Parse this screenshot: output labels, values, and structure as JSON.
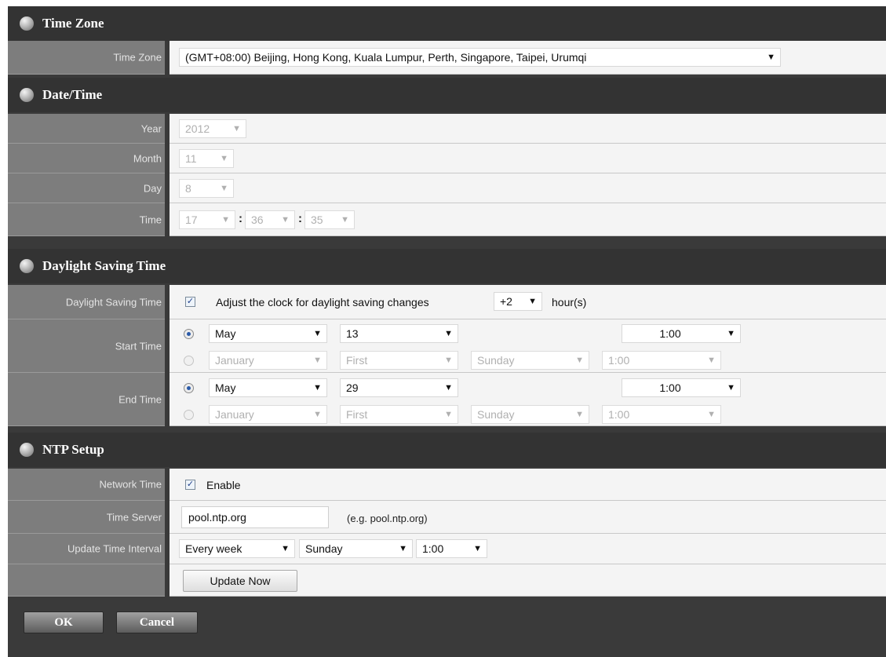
{
  "time_zone_section": {
    "title": "Time Zone",
    "label": "Time Zone",
    "value": "(GMT+08:00) Beijing, Hong Kong, Kuala Lumpur, Perth, Singapore, Taipei, Urumqi"
  },
  "datetime_section": {
    "title": "Date/Time",
    "year_label": "Year",
    "year_value": "2012",
    "month_label": "Month",
    "month_value": "11",
    "day_label": "Day",
    "day_value": "8",
    "time_label": "Time",
    "hour_value": "17",
    "minute_value": "36",
    "second_value": "35",
    "colon": ":"
  },
  "dst_section": {
    "title": "Daylight Saving Time",
    "dst_label": "Daylight Saving Time",
    "adjust_text": "Adjust the clock for daylight saving changes",
    "adjust_checked": true,
    "offset_value": "+2",
    "hours_text": "hour(s)",
    "start_label": "Start Time",
    "start_fixed": {
      "month": "May",
      "day": "13",
      "time": "1:00",
      "selected": true
    },
    "start_relative": {
      "month": "January",
      "week": "First",
      "weekday": "Sunday",
      "time": "1:00",
      "selected": false
    },
    "end_label": "End Time",
    "end_fixed": {
      "month": "May",
      "day": "29",
      "time": "1:00",
      "selected": true
    },
    "end_relative": {
      "month": "January",
      "week": "First",
      "weekday": "Sunday",
      "time": "1:00",
      "selected": false
    }
  },
  "ntp_section": {
    "title": "NTP Setup",
    "network_time_label": "Network Time",
    "enable_text": "Enable",
    "enable_checked": true,
    "time_server_label": "Time Server",
    "time_server_value": "pool.ntp.org",
    "time_server_hint": "(e.g. pool.ntp.org)",
    "interval_label": "Update Time Interval",
    "interval_value": "Every week",
    "interval_day": "Sunday",
    "interval_time": "1:00",
    "update_now_label": "Update Now"
  },
  "footer": {
    "ok_label": "OK",
    "cancel_label": "Cancel"
  },
  "icons": {
    "dropdown": "▼",
    "check": "✓"
  }
}
